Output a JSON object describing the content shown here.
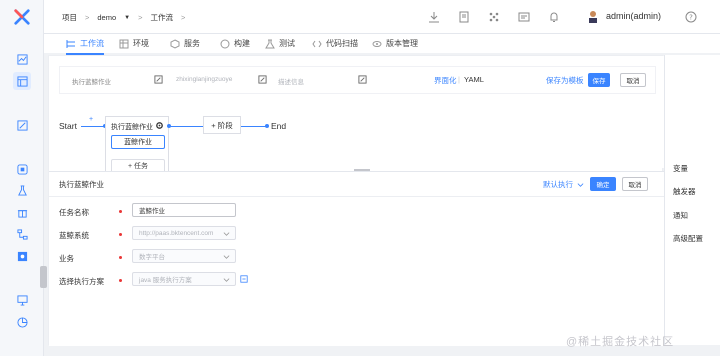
{
  "breadcrumb": {
    "items": [
      "项目",
      "demo",
      "工作流"
    ]
  },
  "user": {
    "name": "admin(admin)"
  },
  "tabs": [
    {
      "label": "工作流",
      "icon": "workflow-icon",
      "active": true
    },
    {
      "label": "环境",
      "icon": "table-icon"
    },
    {
      "label": "服务",
      "icon": "cube-icon"
    },
    {
      "label": "构建",
      "icon": "build-icon"
    },
    {
      "label": "测试",
      "icon": "flask-icon"
    },
    {
      "label": "代码扫描",
      "icon": "code-icon"
    },
    {
      "label": "版本管理",
      "icon": "eye-icon"
    }
  ],
  "workflow_header": {
    "name": "执行蓝鲸作业",
    "key": "zhixinglanjingzuoye",
    "desc_placeholder": "描述信息",
    "gui_link": "界面化",
    "yaml_link": "YAML",
    "save_template": "保存为模板",
    "save": "保存",
    "cancel": "取消"
  },
  "pipeline": {
    "start": "Start",
    "end": "End",
    "plus": "+",
    "stage_title": "执行蓝鲸作业",
    "atom": "蓝鲸作业",
    "add_task": "+ 任务",
    "add_stage": "+ 阶段"
  },
  "panel": {
    "title": "执行蓝鲸作业",
    "mode": "默认执行",
    "confirm": "确定",
    "cancel": "取消",
    "fields": [
      {
        "label": "任务名称",
        "value": "蓝鲸作业"
      },
      {
        "label": "蓝鲸系统",
        "value": "http://paas.bktencent.com"
      },
      {
        "label": "业务",
        "value": "数字平台"
      },
      {
        "label": "选择执行方案",
        "value": "java 服务执行方案"
      }
    ]
  },
  "right_nav": [
    "变量",
    "触发器",
    "通知",
    "高级配置"
  ],
  "watermark": "@稀土掘金技术社区",
  "colors": {
    "accent": "#3a84ff",
    "required": "#ea3636"
  }
}
